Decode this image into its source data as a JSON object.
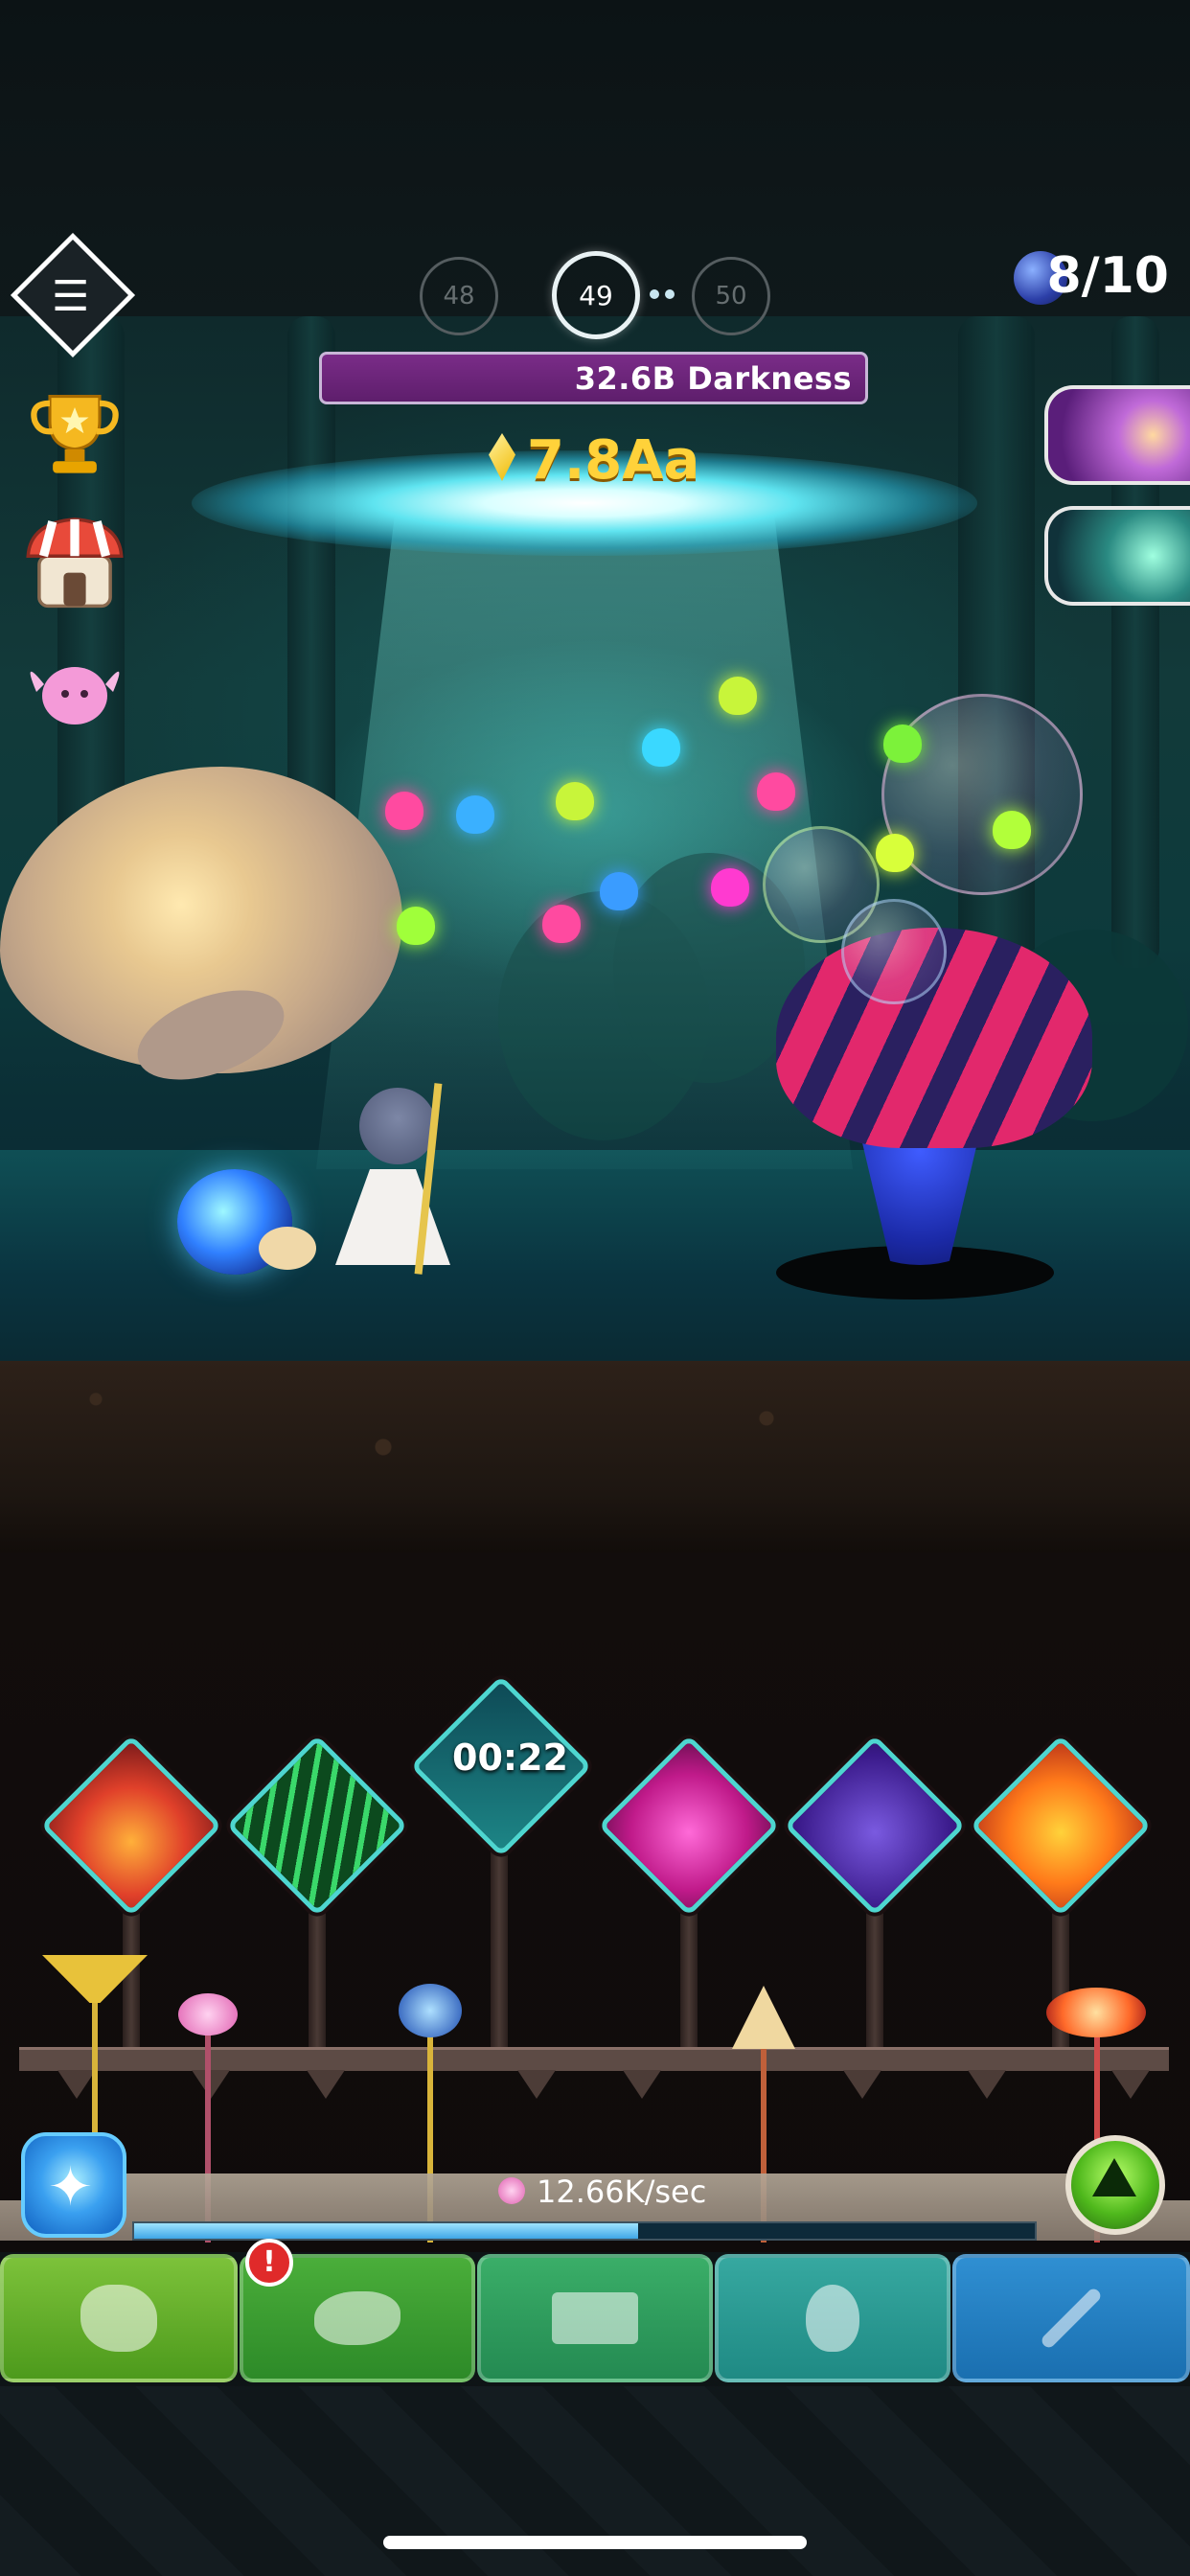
{
  "stage": {
    "previous": "48",
    "current": "49",
    "next": "50"
  },
  "boss": {
    "health_label": "32.6B Darkness"
  },
  "currency": {
    "gold": "7.8Aa"
  },
  "orbs": {
    "count": "8/10"
  },
  "skills": {
    "timer": "00:22"
  },
  "production": {
    "rate": "12.66K/sec",
    "progress_fraction": 0.56
  },
  "alerts": {
    "pet_tab_badge": "!"
  },
  "icons": {
    "menu": "menu-icon",
    "trophy": "trophy-icon",
    "shop": "shop-icon",
    "pet": "pet-icon",
    "orb": "orb-icon",
    "gold": "gem-icon"
  },
  "colors": {
    "hp_bar": "#6a2478",
    "gold_text": "#ffd23a",
    "skill_border": "#4ed6d0",
    "progress_fill": "#3fa6e6"
  }
}
